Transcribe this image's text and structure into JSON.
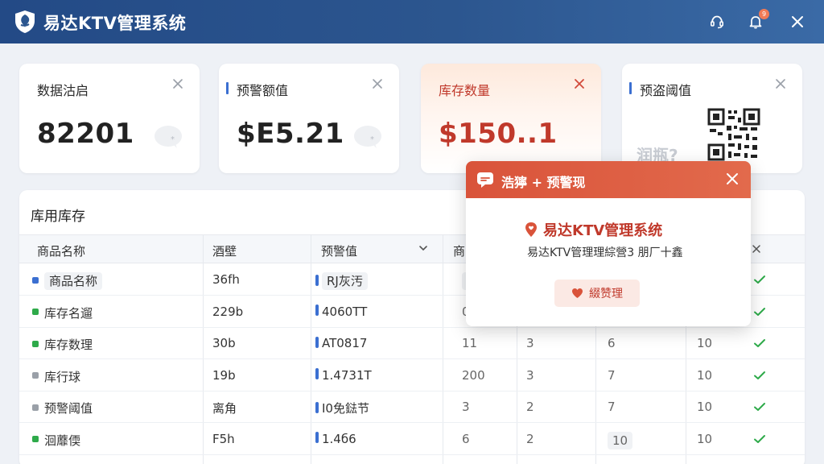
{
  "app": {
    "title": "易达KTV管理系统",
    "notification_count": "9"
  },
  "colors": {
    "header_bg": "#234a86",
    "accent_blue": "#3b6fd1",
    "alert_red": "#d9533a",
    "success_green": "#2eaa4a"
  },
  "cards": [
    {
      "title": "数据沽启",
      "value": "82201",
      "icon": "chat-bubble-icon"
    },
    {
      "title": "预警额值",
      "value": "$E5.21",
      "icon": "chat-bubble-icon"
    },
    {
      "title": "库存数量",
      "value": "$150..1",
      "highlighted": true
    },
    {
      "title": "预盗阈值",
      "icon": "qr-code-icon",
      "watermark": "润瓶?"
    }
  ],
  "table": {
    "title": "库用库存",
    "columns": [
      "商品名称",
      "酒壁",
      "预警值",
      "商"
    ],
    "rows": [
      {
        "name": "商品名称",
        "dot": "#3b6fd1",
        "c2": "36fh",
        "bar": "#3b6fd1",
        "c3": "RJ灰汚",
        "c4": "90",
        "c5": "",
        "c6": "",
        "c7": ""
      },
      {
        "name": "库存名遛",
        "dot": "#2eaa4a",
        "c2": "229b",
        "bar": "#3b6fd1",
        "c3": "4060TT",
        "c4": "0",
        "c5": "",
        "c6": "",
        "c7": ""
      },
      {
        "name": "库存数理",
        "dot": "#2eaa4a",
        "c2": "30b",
        "bar": "#3b6fd1",
        "c3": "AT0817",
        "c4": "11",
        "c5": "3",
        "c6": "6",
        "c7": "10"
      },
      {
        "name": "库行球",
        "dot": "#9aa0a8",
        "c2": "19b",
        "bar": "#3b6fd1",
        "c3": "1.4731T",
        "c4": "200",
        "c5": "3",
        "c6": "7",
        "c7": "10"
      },
      {
        "name": "预警阈值",
        "dot": "#9aa0a8",
        "c2": "离角",
        "bar": "#3b6fd1",
        "c3": "I0免鍅节",
        "c4": "3",
        "c5": "2",
        "c6": "7",
        "c7": "10"
      },
      {
        "name": "洄蘼偄",
        "dot": "#2eaa4a",
        "c2": "F5h",
        "bar": "#3b6fd1",
        "c3": "1.4б6",
        "c4": "6",
        "c5": "2",
        "c6": "10",
        "c7": "10"
      }
    ]
  },
  "popup": {
    "title": "浩獰 + 预警现",
    "brand": "易达KTV管理系统",
    "message": "易达KTV管理理綜營3 朋厂十鑫",
    "button_label": "綴赞理"
  }
}
